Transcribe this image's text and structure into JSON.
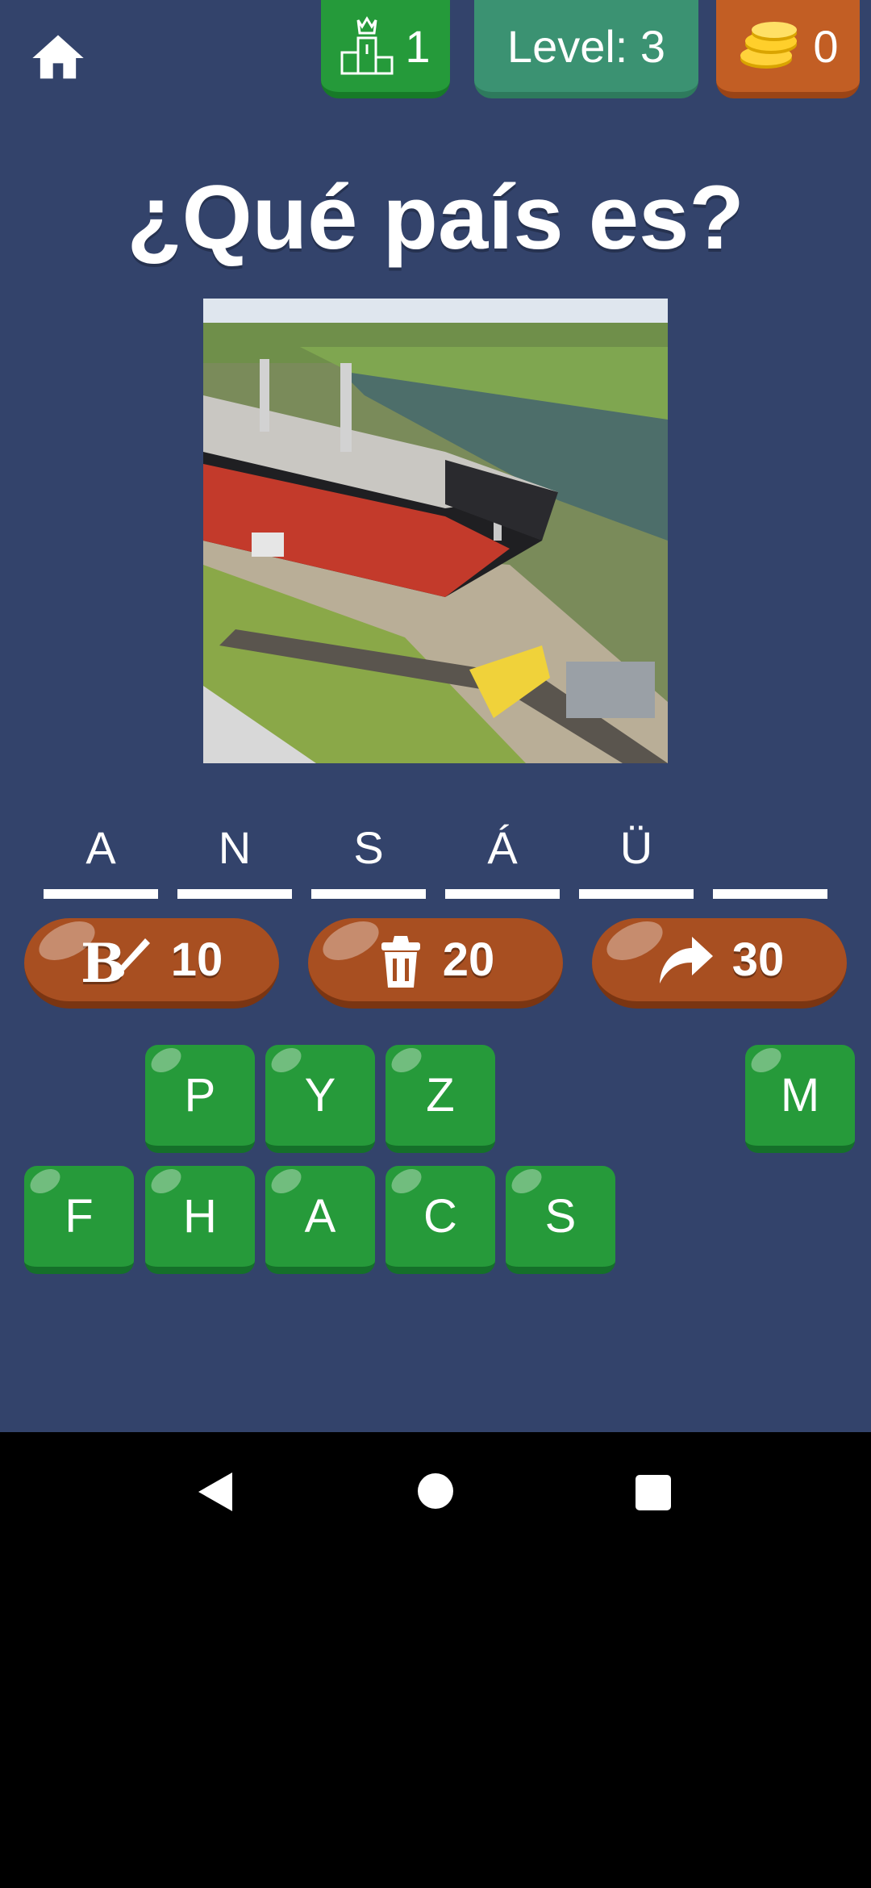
{
  "header": {
    "home_icon": "home-icon",
    "rank_icon": "podium-crown-icon",
    "rank_value": "1",
    "level_label": "Level: 3",
    "coins_icon": "gold-coins-icon",
    "coins_value": "0"
  },
  "question": "¿Qué país es?",
  "answer_slots": [
    "A",
    "N",
    "S",
    "Á",
    "Ü",
    ""
  ],
  "hints": [
    {
      "icon": "brush-hint-icon",
      "cost": "10"
    },
    {
      "icon": "trash-hint-icon",
      "cost": "20"
    },
    {
      "icon": "skip-arrow-icon",
      "cost": "30"
    }
  ],
  "keyboard": {
    "row1": [
      "P",
      "Y",
      "Z",
      "M"
    ],
    "row2": [
      "F",
      "H",
      "A",
      "C",
      "S"
    ]
  },
  "colors": {
    "background": "#33436b",
    "key_green": "#269a3a",
    "hint_brown": "#a84f21",
    "level_teal": "#3b9272",
    "coin_orange": "#c25e24"
  }
}
